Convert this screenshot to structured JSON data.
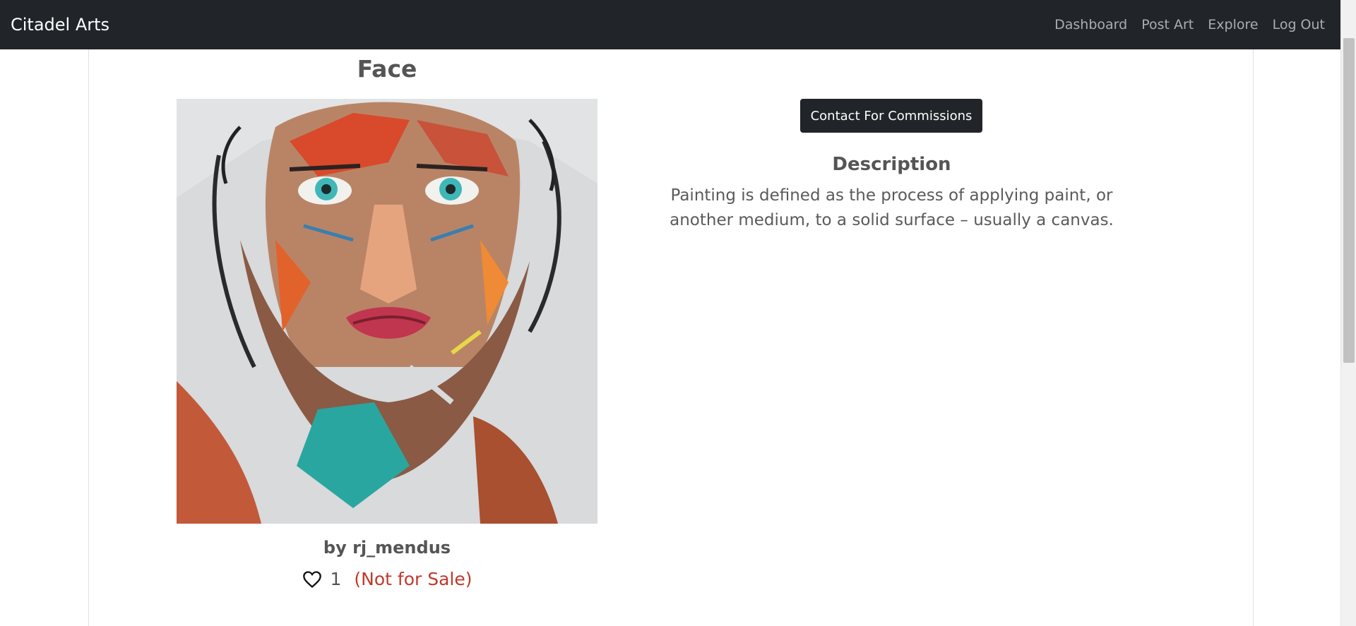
{
  "navbar": {
    "brand": "Citadel Arts",
    "links": [
      "Dashboard",
      "Post Art",
      "Explore",
      "Log Out"
    ]
  },
  "art": {
    "title": "Face",
    "artist_line": "by rj_mendus",
    "likes": "1",
    "sale_status": "(Not for Sale)"
  },
  "actions": {
    "commission_label": "Contact For Commissions"
  },
  "description": {
    "heading": "Description",
    "text": "Painting is defined as the process of applying paint, or another medium, to a solid surface – usually a canvas."
  },
  "icons": {
    "like": "heart-outline-icon"
  },
  "colors": {
    "navbar": "#212529",
    "button": "#212529",
    "not_for_sale": "#c0392b"
  }
}
